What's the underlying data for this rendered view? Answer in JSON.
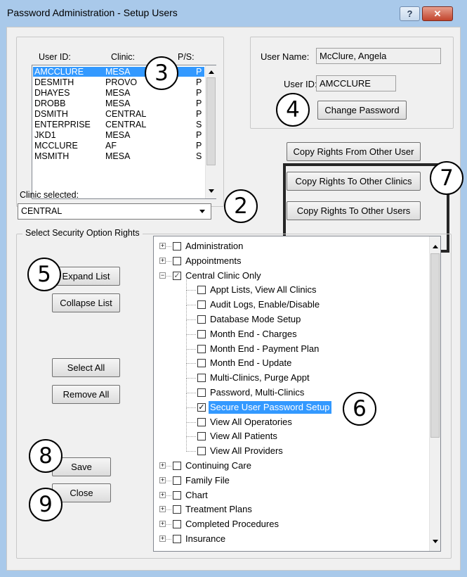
{
  "window": {
    "title": "Password Administration - Setup Users",
    "help_button": "?",
    "close_button": "✕"
  },
  "user_list": {
    "headers": {
      "user_id": "User ID:",
      "clinic": "Clinic:",
      "ps": "P/S:"
    },
    "rows": [
      {
        "user_id": "AMCCLURE",
        "clinic": "MESA",
        "ps": "P",
        "selected": true
      },
      {
        "user_id": "DESMITH",
        "clinic": "PROVO",
        "ps": "P"
      },
      {
        "user_id": "DHAYES",
        "clinic": "MESA",
        "ps": "P"
      },
      {
        "user_id": "DROBB",
        "clinic": "MESA",
        "ps": "P"
      },
      {
        "user_id": "DSMITH",
        "clinic": "CENTRAL",
        "ps": "P"
      },
      {
        "user_id": "ENTERPRISE",
        "clinic": "CENTRAL",
        "ps": "S"
      },
      {
        "user_id": "JKD1",
        "clinic": "MESA",
        "ps": "P"
      },
      {
        "user_id": "MCCLURE",
        "clinic": "AF",
        "ps": "P"
      },
      {
        "user_id": "MSMITH",
        "clinic": "MESA",
        "ps": "S"
      }
    ]
  },
  "user_info": {
    "user_name_label": "User Name:",
    "user_name_value": "McClure, Angela",
    "user_id_label": "User ID:",
    "user_id_value": "AMCCLURE",
    "change_password": "Change Password"
  },
  "copy_rights": {
    "from_other_user": "Copy Rights From Other User",
    "to_other_clinics": "Copy Rights To Other Clinics",
    "to_other_users": "Copy Rights To Other Users"
  },
  "clinic": {
    "label": "Clinic selected:",
    "value": "CENTRAL"
  },
  "security": {
    "group_label": "Select Security Option Rights",
    "expand_list": "Expand List",
    "collapse_list": "Collapse List",
    "select_all": "Select All",
    "remove_all": "Remove All",
    "save": "Save",
    "close": "Close"
  },
  "tree": {
    "items": [
      {
        "label": "Administration",
        "level": 0,
        "checked": false,
        "expander": "+"
      },
      {
        "label": "Appointments",
        "level": 0,
        "checked": false,
        "expander": "+"
      },
      {
        "label": "Central Clinic Only",
        "level": 0,
        "checked": true,
        "expander": "-"
      },
      {
        "label": "Appt Lists, View All Clinics",
        "level": 1,
        "checked": false
      },
      {
        "label": "Audit Logs, Enable/Disable",
        "level": 1,
        "checked": false
      },
      {
        "label": "Database Mode Setup",
        "level": 1,
        "checked": false
      },
      {
        "label": "Month End - Charges",
        "level": 1,
        "checked": false
      },
      {
        "label": "Month End - Payment Plan",
        "level": 1,
        "checked": false
      },
      {
        "label": "Month End - Update",
        "level": 1,
        "checked": false
      },
      {
        "label": "Multi-Clinics, Purge Appt",
        "level": 1,
        "checked": false
      },
      {
        "label": "Password, Multi-Clinics",
        "level": 1,
        "checked": false
      },
      {
        "label": "Secure User Password Setup",
        "level": 1,
        "checked": true,
        "selected": true
      },
      {
        "label": "View All Operatories",
        "level": 1,
        "checked": false
      },
      {
        "label": "View All Patients",
        "level": 1,
        "checked": false
      },
      {
        "label": "View All Providers",
        "level": 1,
        "checked": false
      },
      {
        "label": "Continuing Care",
        "level": 0,
        "checked": false,
        "expander": "+"
      },
      {
        "label": "Family File",
        "level": 0,
        "checked": false,
        "expander": "+"
      },
      {
        "label": "Chart",
        "level": 0,
        "checked": false,
        "expander": "+"
      },
      {
        "label": "Treatment Plans",
        "level": 0,
        "checked": false,
        "expander": "+"
      },
      {
        "label": "Completed Procedures",
        "level": 0,
        "checked": false,
        "expander": "+"
      },
      {
        "label": "Insurance",
        "level": 0,
        "checked": false,
        "expander": "+"
      }
    ]
  },
  "callouts": {
    "c2": "2",
    "c3": "3",
    "c4": "4",
    "c5": "5",
    "c6": "6",
    "c7": "7",
    "c8": "8",
    "c9": "9"
  }
}
